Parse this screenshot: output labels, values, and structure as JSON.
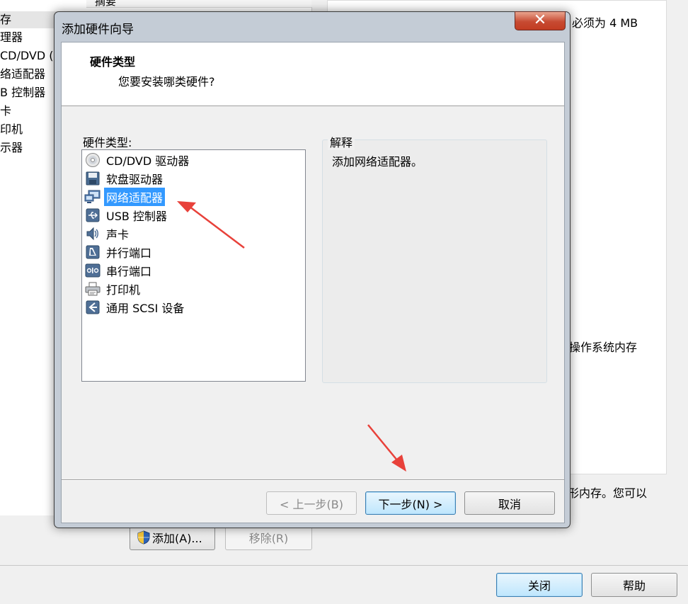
{
  "background": {
    "left_list": {
      "items": [
        "存",
        "理器",
        "CD/DVD (",
        "络适配器",
        "B 控制器",
        "卡",
        "印机",
        "示器"
      ],
      "selected_index": 0
    },
    "list_header": "摘要",
    "right_texts": {
      "memory_min": "必须为 4 MB",
      "os_memory": "操作系统内存",
      "shape_memory": "形内存。您可以"
    },
    "add_button": "添加(A)...",
    "remove_button": "移除(R)",
    "close_button": "关闭",
    "help_button": "帮助"
  },
  "dialog": {
    "title": "添加硬件向导",
    "close_glyph": "✕",
    "header_title": "硬件类型",
    "header_subtitle": "您要安装哪类硬件?",
    "list_label": "硬件类型:",
    "hardware_items": [
      {
        "label": "CD/DVD 驱动器",
        "icon": "cd-dvd-icon"
      },
      {
        "label": "软盘驱动器",
        "icon": "floppy-icon"
      },
      {
        "label": "网络适配器",
        "icon": "network-adapter-icon"
      },
      {
        "label": "USB 控制器",
        "icon": "usb-icon"
      },
      {
        "label": "声卡",
        "icon": "sound-card-icon"
      },
      {
        "label": "并行端口",
        "icon": "parallel-port-icon"
      },
      {
        "label": "串行端口",
        "icon": "serial-port-icon"
      },
      {
        "label": "打印机",
        "icon": "printer-icon"
      },
      {
        "label": "通用 SCSI 设备",
        "icon": "scsi-icon"
      }
    ],
    "selected_index": 2,
    "explanation_label": "解释",
    "explanation_text": "添加网络适配器。",
    "back_button": "< 上一步(B)",
    "next_button": "下一步(N) >",
    "cancel_button": "取消"
  },
  "colors": {
    "selection": "#3399ff",
    "annotation_arrow": "#e8413a"
  }
}
